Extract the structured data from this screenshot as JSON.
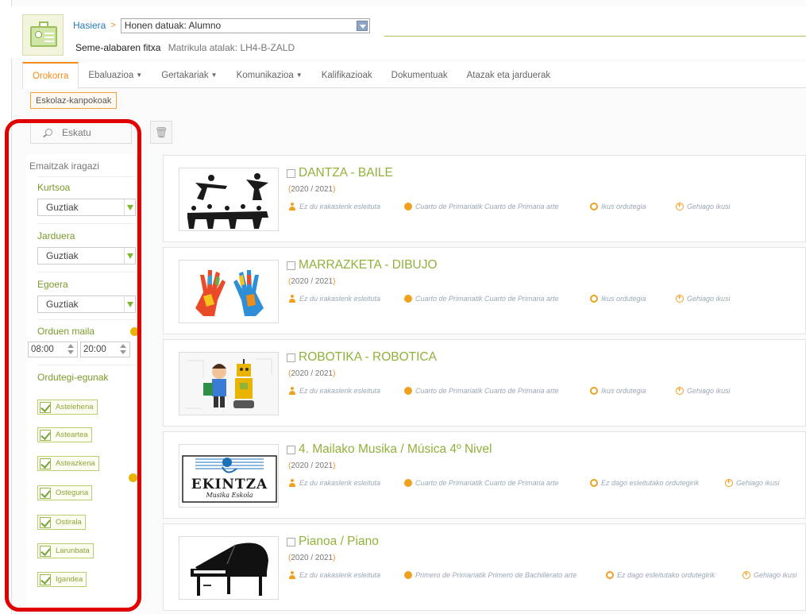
{
  "breadcrumb": {
    "home": "Hasiera",
    "separator": ">",
    "selector_value": "Honen datuak: Alumno"
  },
  "header": {
    "title": "Seme-alabaren fitxa",
    "meta": "Matrikula atalak: LH4-B-ZALD"
  },
  "tabs": [
    {
      "label": "Orokorra",
      "active": true,
      "dropdown": false
    },
    {
      "label": "Ebaluazioa",
      "active": false,
      "dropdown": true
    },
    {
      "label": "Gertakariak",
      "active": false,
      "dropdown": true
    },
    {
      "label": "Komunikazioa",
      "active": false,
      "dropdown": true
    },
    {
      "label": "Kalifikazioak",
      "active": false,
      "dropdown": false
    },
    {
      "label": "Dokumentuak",
      "active": false,
      "dropdown": false
    },
    {
      "label": "Atazak eta jarduerak",
      "active": false,
      "dropdown": false
    }
  ],
  "subtab": {
    "label": "Eskolaz-kanpokoak"
  },
  "sidebar": {
    "search_label": "Eskatu",
    "filter_title": "Emaitzak iragazi",
    "kurtsoa": {
      "label": "Kurtsoa",
      "value": "Guztiak"
    },
    "jarduera": {
      "label": "Jarduera",
      "value": "Guztiak"
    },
    "egoera": {
      "label": "Egoera",
      "value": "Guztiak"
    },
    "orduen_maila": {
      "label": "Orduen maila",
      "from": "08:00",
      "to": "20:00"
    },
    "ordutegi_egunak": {
      "label": "Ordutegi-egunak",
      "days": [
        "Astelehena",
        "Asteartea",
        "Asteazkena",
        "Osteguna",
        "Ostirala",
        "Larunbata",
        "Igandea"
      ]
    }
  },
  "activities": [
    {
      "title": "DANTZA - BAILE",
      "year": "2020 / 2021",
      "teacher": "Ez du irakaslerik esleituta",
      "levels": "Cuarto de Primariatik Cuarto de Primaria arte",
      "schedule": "Ikus ordutegia",
      "more": "Gehiago ikusi"
    },
    {
      "title": "MARRAZKETA - DIBUJO",
      "year": "2020 / 2021",
      "teacher": "Ez du irakaslerik esleituta",
      "levels": "Cuarto de Primariatik Cuarto de Primaria arte",
      "schedule": "Ikus ordutegia",
      "more": "Gehiago ikusi"
    },
    {
      "title": "ROBOTIKA - ROBOTICA",
      "year": "2020 / 2021",
      "teacher": "Ez du irakaslerik esleituta",
      "levels": "Cuarto de Primariatik Cuarto de Primaria arte",
      "schedule": "Ikus ordutegia",
      "more": "Gehiago ikusi"
    },
    {
      "title": "4. Mailako Musika / Música 4º Nivel",
      "year": "2020 / 2021",
      "teacher": "Ez du irakaslerik esleituta",
      "levels": "Cuarto de Primariatik Cuarto de Primaria arte",
      "schedule": "Ez dago esleitutako ordutegirik",
      "more": "Gehiago ikusi",
      "logo_text": "EKINTZA",
      "logo_sub": "Musika Eskola"
    },
    {
      "title": "Pianoa / Piano",
      "year": "2020 / 2021",
      "teacher": "Ez du irakaslerik esleituta",
      "levels": "Primero de Primariatik Primero de Bachillerato arte",
      "schedule": "Ez dago esleitutako ordutegirik",
      "more": "Gehiago ikusi"
    }
  ],
  "colors": {
    "accent_orange": "#f08c1a",
    "accent_green": "#8fb23a",
    "highlight_red": "#e00000",
    "link_blue": "#2a7ab8"
  }
}
